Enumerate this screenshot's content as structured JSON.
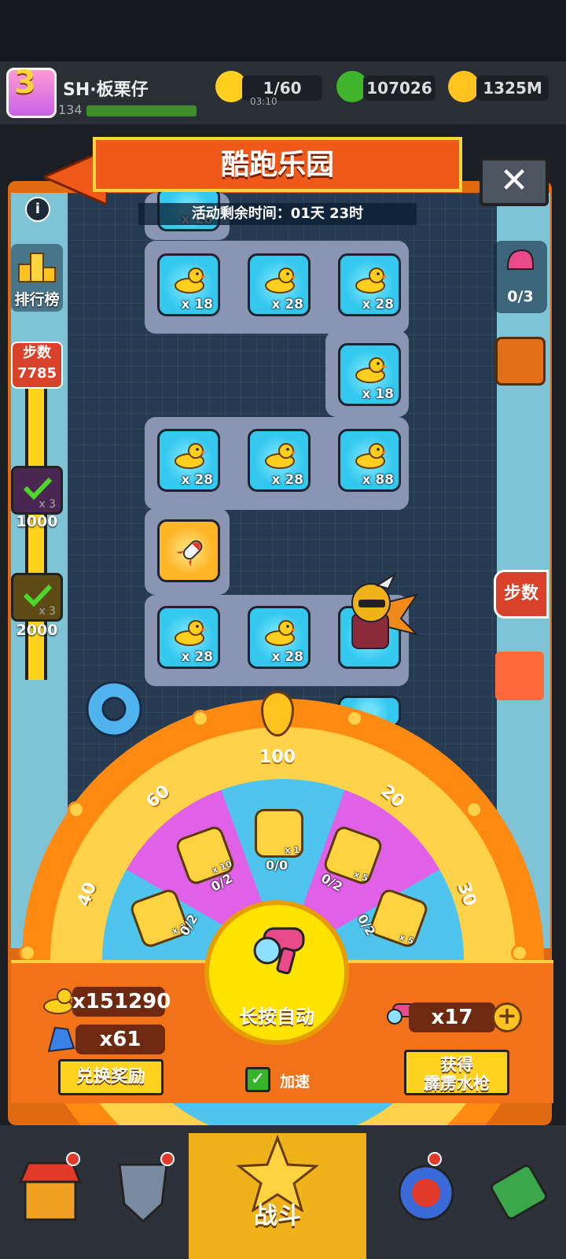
{
  "player": {
    "name": "SH·板栗仔",
    "level": "3",
    "xp": "134"
  },
  "resources": {
    "energy": "1/60",
    "energy_timer": "03:10",
    "gems": "107026",
    "coins": "1325M"
  },
  "event": {
    "title": "酷跑乐园",
    "timer_label": "活动剩余时间：01天 23时"
  },
  "sidebar_left": {
    "info_icon": "i",
    "rank_label": "排行榜",
    "steps_label": "步数",
    "steps_value": "7785",
    "milestones": [
      {
        "mult": "x 3",
        "value": "1000"
      },
      {
        "mult": "x 3",
        "value": "2000"
      }
    ]
  },
  "sidebar_right": {
    "collect_count": "0/3",
    "steps_button": "步数"
  },
  "board": {
    "tiles": [
      {
        "count": "x 28"
      },
      {
        "count": "x 18"
      },
      {
        "count": "x 28"
      },
      {
        "count": "x 28"
      },
      {
        "count": "x 18"
      },
      {
        "count": "x 28"
      },
      {
        "count": "x 28"
      },
      {
        "count": "x 88"
      },
      {
        "count": "x 28"
      },
      {
        "count": "x 28"
      }
    ]
  },
  "wheel": {
    "segments": [
      "100",
      "60",
      "20",
      "40",
      "30"
    ],
    "items": [
      {
        "name": "gift-box",
        "count": "x 1",
        "progress": "0/0"
      },
      {
        "name": "flipper",
        "count": "x 10",
        "progress": "0/2"
      },
      {
        "name": "present",
        "count": "x 5",
        "progress": "0/2"
      },
      {
        "name": "gift-box-2",
        "count": "x 1",
        "progress": "0/2"
      },
      {
        "name": "present-2",
        "count": "x 5",
        "progress": "0/2"
      }
    ]
  },
  "controls": {
    "duck_count": "x151290",
    "flipper_count": "x61",
    "exchange_label": "兑换奖励",
    "spin_label": "长按自动",
    "speed_label": "加速",
    "gun_count": "x17",
    "get_gun_line1": "获得",
    "get_gun_line2": "霹雳水枪"
  },
  "nav": {
    "battle_label": "战斗"
  },
  "colors": {
    "accent": "#f2721a",
    "wheel_blue": "#4ec4ef",
    "wheel_pink": "#e060e8",
    "tile_blue": "#35c8ef"
  }
}
